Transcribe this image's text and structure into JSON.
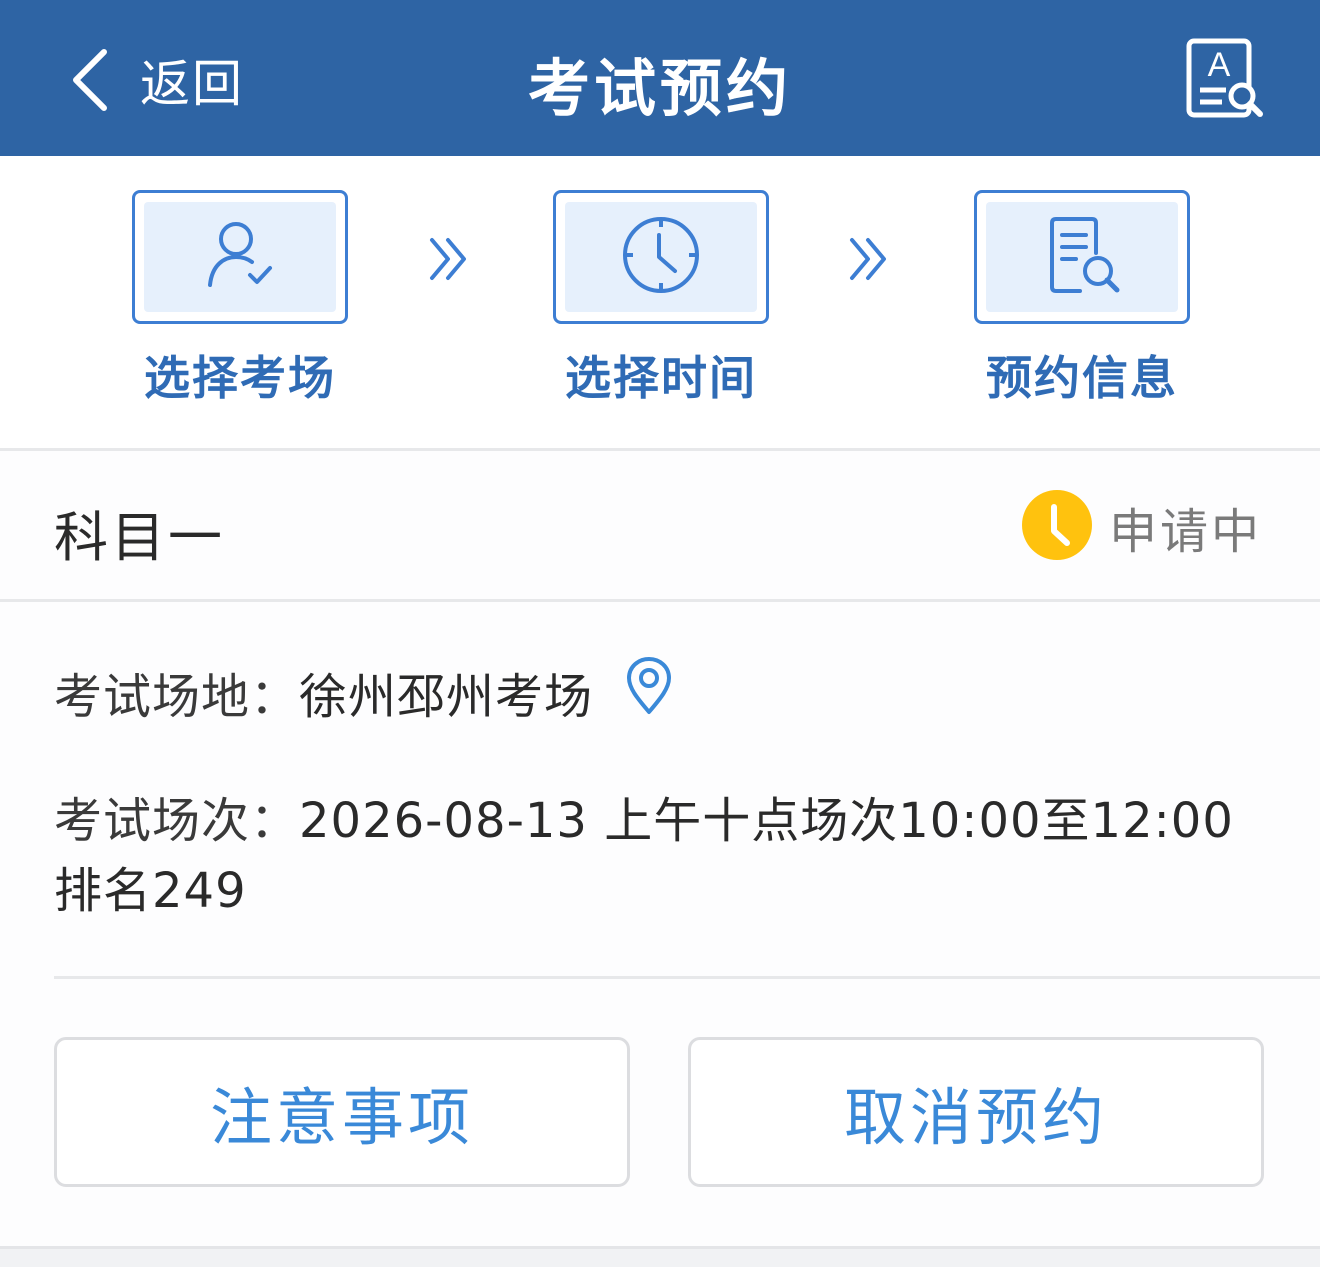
{
  "header": {
    "back_label": "返回",
    "title": "考试预约",
    "back_icon": "chevron-left-icon",
    "right_icon": "document-search-icon"
  },
  "steps": [
    {
      "label": "选择考场",
      "icon": "user-check-icon"
    },
    {
      "label": "选择时间",
      "icon": "clock-icon"
    },
    {
      "label": "预约信息",
      "icon": "document-search-icon"
    }
  ],
  "subject": {
    "title": "科目一",
    "status": "申请中",
    "status_icon": "clock-icon",
    "status_color": "#ffc20e"
  },
  "info": {
    "location_key": "考试场地：",
    "location_value": "徐州邳州考场",
    "session_key": "考试场次：",
    "session_value": "2026-08-13 上午十点场次10:00至12:00 排名249"
  },
  "actions": {
    "notice_label": "注意事项",
    "cancel_label": "取消预约"
  },
  "colors": {
    "header_bg": "#2e64a4",
    "accent": "#3d7ed3",
    "button_text": "#3a89d8"
  }
}
